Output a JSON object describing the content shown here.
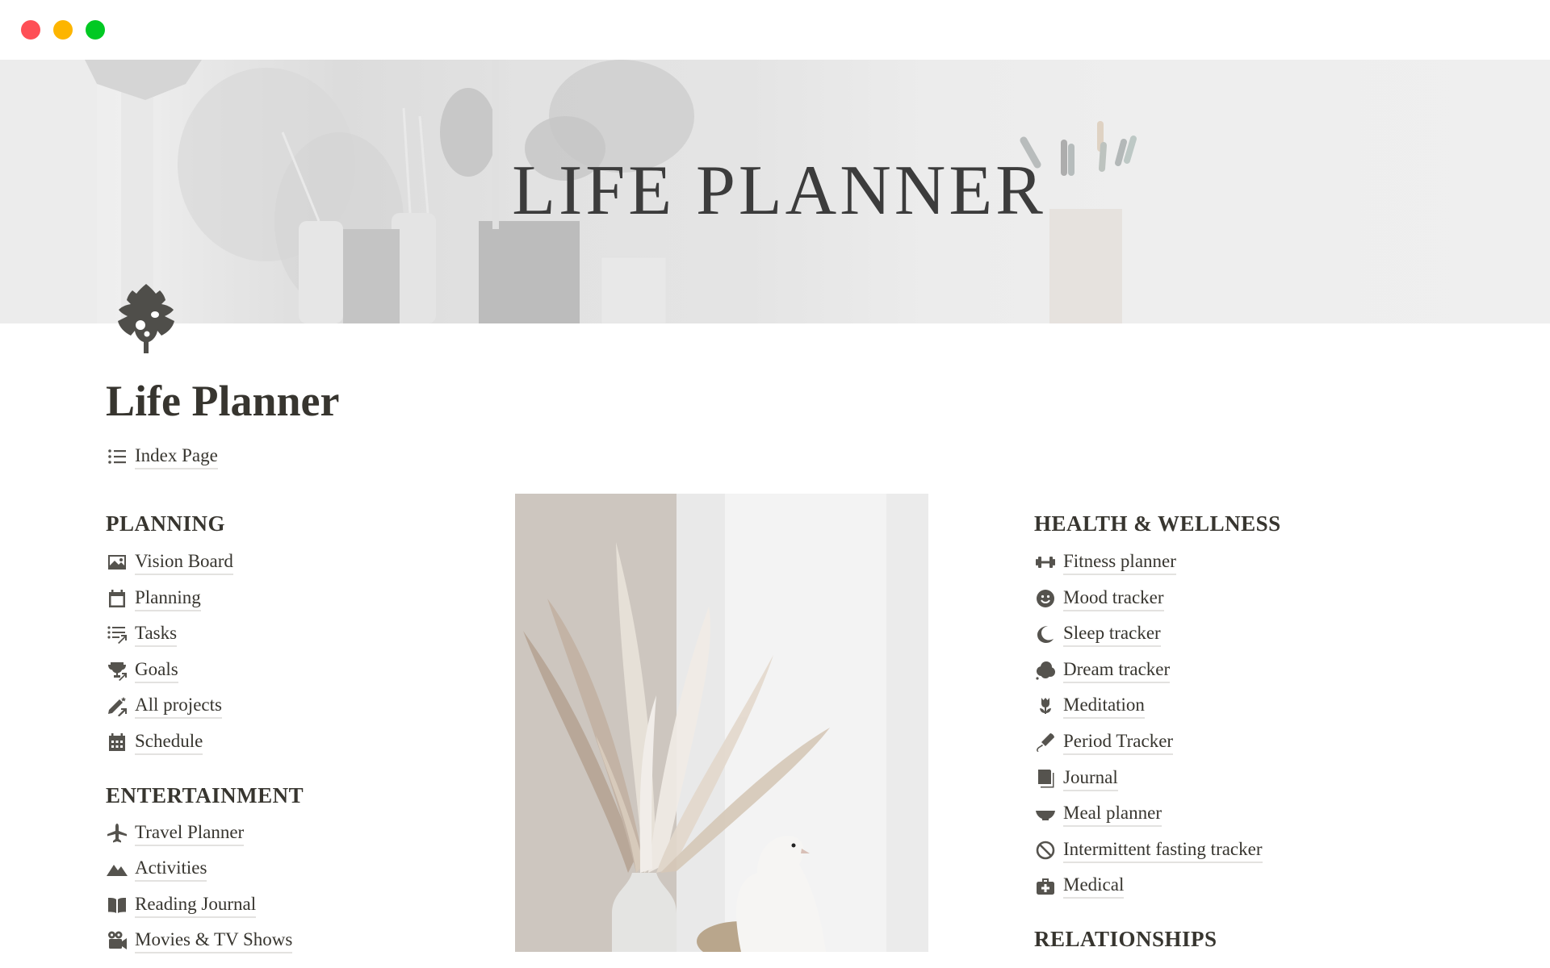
{
  "window": {
    "controls": [
      "close",
      "minimize",
      "maximize"
    ]
  },
  "cover": {
    "title": "LIFE PLANNER"
  },
  "page": {
    "icon": "monstera-leaf-icon",
    "title": "Life Planner",
    "index_link": {
      "label": "Index Page",
      "icon": "list-icon"
    }
  },
  "sections": {
    "planning": {
      "heading": "PLANNING",
      "items": [
        {
          "label": "Vision Board",
          "icon": "image-icon"
        },
        {
          "label": "Planning",
          "icon": "calendar-icon"
        },
        {
          "label": "Tasks",
          "icon": "checklist-icon"
        },
        {
          "label": "Goals",
          "icon": "trophy-icon"
        },
        {
          "label": "All projects",
          "icon": "pencil-icon"
        },
        {
          "label": "Schedule",
          "icon": "calendar-grid-icon"
        }
      ]
    },
    "entertainment": {
      "heading": "ENTERTAINMENT",
      "items": [
        {
          "label": "Travel Planner",
          "icon": "airplane-icon"
        },
        {
          "label": "Activities",
          "icon": "mountain-icon"
        },
        {
          "label": "Reading Journal",
          "icon": "book-icon"
        },
        {
          "label": "Movies & TV Shows",
          "icon": "video-camera-icon"
        }
      ]
    },
    "health": {
      "heading": "HEALTH & WELLNESS",
      "items": [
        {
          "label": "Fitness planner",
          "icon": "dumbbell-icon"
        },
        {
          "label": "Mood tracker",
          "icon": "smiley-icon"
        },
        {
          "label": "Sleep tracker",
          "icon": "moon-icon"
        },
        {
          "label": "Dream tracker",
          "icon": "thought-cloud-icon"
        },
        {
          "label": "Meditation",
          "icon": "lotus-icon"
        },
        {
          "label": "Period Tracker",
          "icon": "tampon-icon"
        },
        {
          "label": "Journal",
          "icon": "notebook-icon"
        },
        {
          "label": "Meal planner",
          "icon": "bowl-icon"
        },
        {
          "label": "Intermittent fasting tracker",
          "icon": "prohibited-icon"
        },
        {
          "label": "Medical",
          "icon": "first-aid-kit-icon"
        }
      ]
    },
    "relationships": {
      "heading": "RELATIONSHIPS"
    }
  },
  "photo": {
    "alt": "Dried pampas grass bouquet in white vase with white dove"
  }
}
